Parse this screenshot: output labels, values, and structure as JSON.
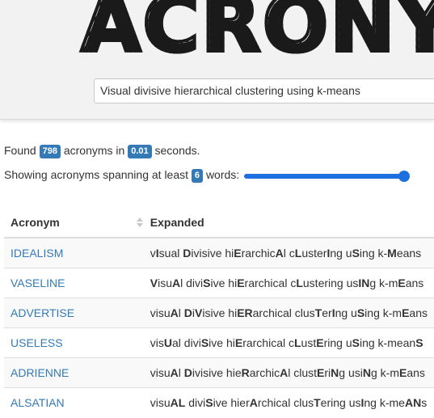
{
  "header": {
    "logo_text": "ACRONYM",
    "search_value": "Visual divisive hierarchical clustering using k-means"
  },
  "stats": {
    "found_prefix": "Found",
    "found_count": "798",
    "found_middle": "acronyms in",
    "time": "0.01",
    "time_suffix": "seconds.",
    "span_prefix": "Showing acronyms spanning at least",
    "min_words": "6",
    "span_suffix": "words:",
    "slider_fraction": 1.0
  },
  "table": {
    "headers": {
      "acronym": "Acronym",
      "expanded": "Expanded"
    },
    "rows": [
      {
        "acronym": "IDEALISM",
        "segments": [
          [
            "v",
            0
          ],
          [
            "I",
            1
          ],
          [
            "sual ",
            0
          ],
          [
            "D",
            1
          ],
          [
            "ivisive hi",
            0
          ],
          [
            "E",
            1
          ],
          [
            "rarchic",
            0
          ],
          [
            "A",
            1
          ],
          [
            "l c",
            0
          ],
          [
            "L",
            1
          ],
          [
            "uster",
            0
          ],
          [
            "I",
            1
          ],
          [
            "ng u",
            0
          ],
          [
            "S",
            1
          ],
          [
            "ing k-",
            0
          ],
          [
            "M",
            1
          ],
          [
            "eans",
            0
          ]
        ]
      },
      {
        "acronym": "VASELINE",
        "segments": [
          [
            "V",
            1
          ],
          [
            "isu",
            0
          ],
          [
            "A",
            1
          ],
          [
            "l divi",
            0
          ],
          [
            "S",
            1
          ],
          [
            "ive hi",
            0
          ],
          [
            "E",
            1
          ],
          [
            "rarchical c",
            0
          ],
          [
            "L",
            1
          ],
          [
            "ustering us",
            0
          ],
          [
            "IN",
            1
          ],
          [
            "g k-m",
            0
          ],
          [
            "E",
            1
          ],
          [
            "ans",
            0
          ]
        ]
      },
      {
        "acronym": "ADVERTISE",
        "segments": [
          [
            "visu",
            0
          ],
          [
            "A",
            1
          ],
          [
            "l ",
            0
          ],
          [
            "D",
            1
          ],
          [
            "i",
            0
          ],
          [
            "V",
            1
          ],
          [
            "isive hi",
            0
          ],
          [
            "ER",
            1
          ],
          [
            "archical clus",
            0
          ],
          [
            "T",
            1
          ],
          [
            "er",
            0
          ],
          [
            "I",
            1
          ],
          [
            "ng u",
            0
          ],
          [
            "S",
            1
          ],
          [
            "ing k-m",
            0
          ],
          [
            "E",
            1
          ],
          [
            "ans",
            0
          ]
        ]
      },
      {
        "acronym": "USELESS",
        "segments": [
          [
            "vis",
            0
          ],
          [
            "U",
            1
          ],
          [
            "al divi",
            0
          ],
          [
            "S",
            1
          ],
          [
            "ive hi",
            0
          ],
          [
            "E",
            1
          ],
          [
            "rarchical c",
            0
          ],
          [
            "L",
            1
          ],
          [
            "ust",
            0
          ],
          [
            "E",
            1
          ],
          [
            "ring u",
            0
          ],
          [
            "S",
            1
          ],
          [
            "ing k-mean",
            0
          ],
          [
            "S",
            1
          ]
        ]
      },
      {
        "acronym": "ADRIENNE",
        "segments": [
          [
            "visu",
            0
          ],
          [
            "A",
            1
          ],
          [
            "l ",
            0
          ],
          [
            "D",
            1
          ],
          [
            "ivisive hie",
            0
          ],
          [
            "R",
            1
          ],
          [
            "archic",
            0
          ],
          [
            "A",
            1
          ],
          [
            "l clust",
            0
          ],
          [
            "E",
            1
          ],
          [
            "ri",
            0
          ],
          [
            "N",
            1
          ],
          [
            "g usi",
            0
          ],
          [
            "N",
            1
          ],
          [
            "g k-m",
            0
          ],
          [
            "E",
            1
          ],
          [
            "ans",
            0
          ]
        ]
      },
      {
        "acronym": "ALSATIAN",
        "segments": [
          [
            "visu",
            0
          ],
          [
            "AL",
            1
          ],
          [
            " divi",
            0
          ],
          [
            "S",
            1
          ],
          [
            "ive hier",
            0
          ],
          [
            "A",
            1
          ],
          [
            "rchical clus",
            0
          ],
          [
            "T",
            1
          ],
          [
            "ering us",
            0
          ],
          [
            "I",
            1
          ],
          [
            "ng k-me",
            0
          ],
          [
            "AN",
            1
          ],
          [
            "s",
            0
          ]
        ]
      }
    ]
  }
}
